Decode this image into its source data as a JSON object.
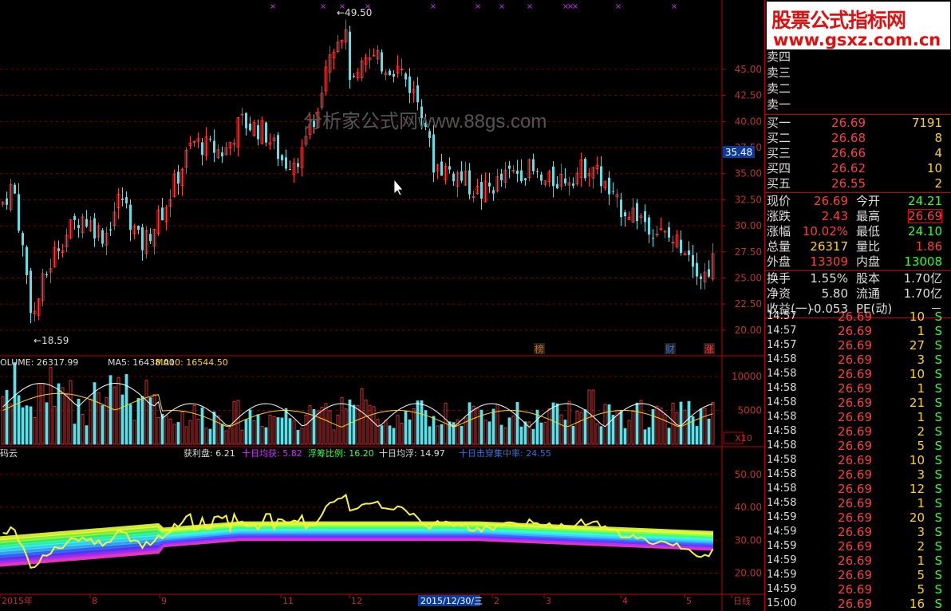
{
  "watermark": {
    "line1": "股票公式指标网",
    "line2": "www.gsxz.com.cn",
    "center": "分析家公式网www.88gs.com"
  },
  "chart_data": {
    "type": "candlestick",
    "price_axis": [
      20.0,
      22.5,
      25.0,
      27.5,
      30.0,
      32.5,
      35.0,
      37.5,
      40.0,
      42.5,
      45.0
    ],
    "ylim": [
      18,
      50.5
    ],
    "high_label": "49.50",
    "low_label": "18.59",
    "current_tag": "35.48",
    "markers": [
      "榜",
      "财",
      "涨"
    ],
    "volume_label": "OLUME: 26317.99",
    "ma5_label": "MA5: 16438.00",
    "ma10_label": "MA10: 16544.50",
    "volume_axis": [
      5000,
      10000
    ],
    "volume_unit": "X10",
    "chip_panel": {
      "name": "码云",
      "profit_label": "获利盘: 6.21",
      "avg10_label": "十日均获: 5.82",
      "float_label": "浮筹比例: 16.20",
      "float10_label": "十日均浮: 14.97",
      "ten_label": "十日击穿集中率: 24.55"
    },
    "chip_axis": [
      20.0,
      30.0,
      40.0,
      50.0
    ],
    "x_labels": [
      "2015年",
      "8",
      "9",
      "11",
      "12",
      "2015/12/30/三",
      "2",
      "3",
      "4",
      "5",
      "日线"
    ]
  },
  "quote": {
    "ask": [
      {
        "label": "卖四"
      },
      {
        "label": "卖三"
      },
      {
        "label": "卖二"
      },
      {
        "label": "卖一"
      }
    ],
    "bid": [
      {
        "label": "买一",
        "price": "26.69",
        "vol": "7191"
      },
      {
        "label": "买二",
        "price": "26.68",
        "vol": "8"
      },
      {
        "label": "买三",
        "price": "26.66",
        "vol": "4"
      },
      {
        "label": "买四",
        "price": "26.62",
        "vol": "10"
      },
      {
        "label": "买五",
        "price": "26.55",
        "vol": "2"
      }
    ],
    "stats": [
      {
        "l": "现价",
        "v": "26.69",
        "l2": "今开",
        "v2": "24.21",
        "c2": "g"
      },
      {
        "l": "涨跌",
        "v": "2.43",
        "l2": "最高",
        "v2": "26.69",
        "c2": "boxed"
      },
      {
        "l": "涨幅",
        "v": "10.02%",
        "l2": "最低",
        "v2": "24.10",
        "c2": "g"
      },
      {
        "l": "总量",
        "v": "26317",
        "l2": "量比",
        "v2": "1.86",
        "c1": "y"
      },
      {
        "l": "外盘",
        "v": "13309",
        "l2": "内盘",
        "v2": "13008",
        "c2": "g"
      },
      {
        "l": "换手",
        "v": "1.55%",
        "l2": "股本",
        "v2": "1.70亿",
        "c1": "w",
        "c2": "w"
      },
      {
        "l": "净资",
        "v": "5.80",
        "l2": "流通",
        "v2": "1.70亿",
        "c1": "w",
        "c2": "w"
      },
      {
        "l": "收益(一)",
        "v": "-0.053",
        "l2": "PE(动)",
        "v2": "－",
        "c1": "w",
        "c2": "w"
      }
    ],
    "ticks": [
      {
        "t": "14:57",
        "p": "26.69",
        "v": "10",
        "s": "S"
      },
      {
        "t": "14:57",
        "p": "26.69",
        "v": "1",
        "s": "S"
      },
      {
        "t": "14:57",
        "p": "26.69",
        "v": "27",
        "s": "S"
      },
      {
        "t": "14:58",
        "p": "26.69",
        "v": "3",
        "s": "S"
      },
      {
        "t": "14:58",
        "p": "26.69",
        "v": "10",
        "s": "S"
      },
      {
        "t": "14:58",
        "p": "26.69",
        "v": "1",
        "s": "S"
      },
      {
        "t": "14:58",
        "p": "26.69",
        "v": "21",
        "s": "S"
      },
      {
        "t": "14:58",
        "p": "26.69",
        "v": "1",
        "s": "S"
      },
      {
        "t": "14:58",
        "p": "26.69",
        "v": "2",
        "s": "S"
      },
      {
        "t": "14:58",
        "p": "26.69",
        "v": "5",
        "s": "S"
      },
      {
        "t": "14:58",
        "p": "26.69",
        "v": "10",
        "s": "S"
      },
      {
        "t": "14:58",
        "p": "26.69",
        "v": "3",
        "s": "S"
      },
      {
        "t": "14:58",
        "p": "26.69",
        "v": "12",
        "s": "S"
      },
      {
        "t": "14:58",
        "p": "26.69",
        "v": "1",
        "s": "S"
      },
      {
        "t": "14:59",
        "p": "26.69",
        "v": "20",
        "s": "S"
      },
      {
        "t": "14:59",
        "p": "26.69",
        "v": "3",
        "s": "S"
      },
      {
        "t": "14:59",
        "p": "26.69",
        "v": "2",
        "s": "S"
      },
      {
        "t": "14:59",
        "p": "26.69",
        "v": "1",
        "s": "S"
      },
      {
        "t": "14:59",
        "p": "26.69",
        "v": "5",
        "s": "S"
      },
      {
        "t": "14:59",
        "p": "26.69",
        "v": "5",
        "s": "S"
      },
      {
        "t": "15:00",
        "p": "26.69",
        "v": "16",
        "s": "S"
      }
    ]
  }
}
